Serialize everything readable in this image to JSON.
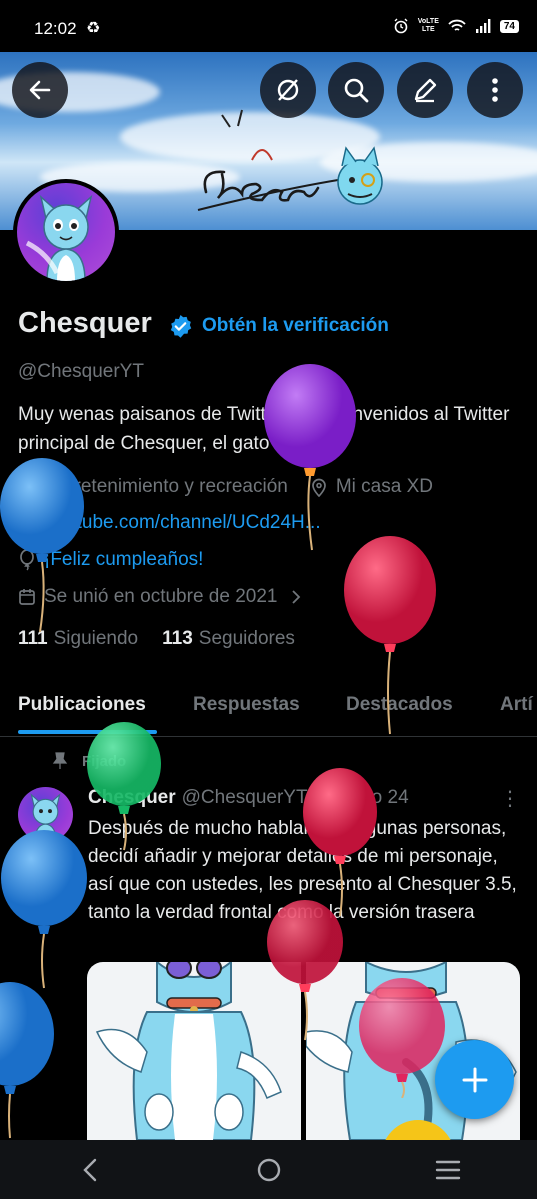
{
  "status_bar": {
    "time": "12:02",
    "battery": "74",
    "network": "VoLTE",
    "network_sub": "LTE"
  },
  "banner": {
    "signature": "Chesquer"
  },
  "profile": {
    "name": "Chesquer",
    "verify_cta": "Obtén la verificación",
    "handle": "@ChesquerYT",
    "bio": "Muy wenas paisanos de Twitter o X, bienvenidos al Twitter principal de Chesquer, el gato azul",
    "category": "Entretenimiento y recreación",
    "location": "Mi casa XD",
    "website": "youtube.com/channel/UCd24H...",
    "birthday": "¡Feliz cumpleaños!",
    "joined": "Se unió en octubre de 2021",
    "following_count": "111",
    "following_label": "Siguiendo",
    "followers_count": "113",
    "followers_label": "Seguidores"
  },
  "tabs": [
    {
      "label": "Publicaciones",
      "active": true
    },
    {
      "label": "Respuestas",
      "active": false
    },
    {
      "label": "Destacados",
      "active": false
    },
    {
      "label": "Artí",
      "active": false
    }
  ],
  "post": {
    "pinned_label": "Fijado",
    "author": "Chesquer",
    "handle": "@ChesquerYT",
    "separator": "·",
    "date": "03 ago 24",
    "text": "Después de mucho hablar con algunas personas, decidí añadir y mejorar detalles de mi personaje, así que con ustedes, les presento al Chesquer 3.5, tanto la verdad frontal como la versión trasera"
  },
  "icons": {
    "back": "back-arrow-icon",
    "grok": "grok-icon",
    "search": "search-icon",
    "edit": "edit-icon",
    "more": "more-vertical-icon",
    "verified": "verified-badge-icon",
    "category": "briefcase-icon",
    "location": "location-pin-icon",
    "link": "link-icon",
    "birthday": "balloon-icon",
    "calendar": "calendar-icon",
    "pin": "pin-icon",
    "compose": "plus-icon"
  },
  "colors": {
    "accent": "#1d9bf0",
    "text_primary": "#e7e9ea",
    "text_secondary": "#71767b",
    "background": "#000000"
  }
}
